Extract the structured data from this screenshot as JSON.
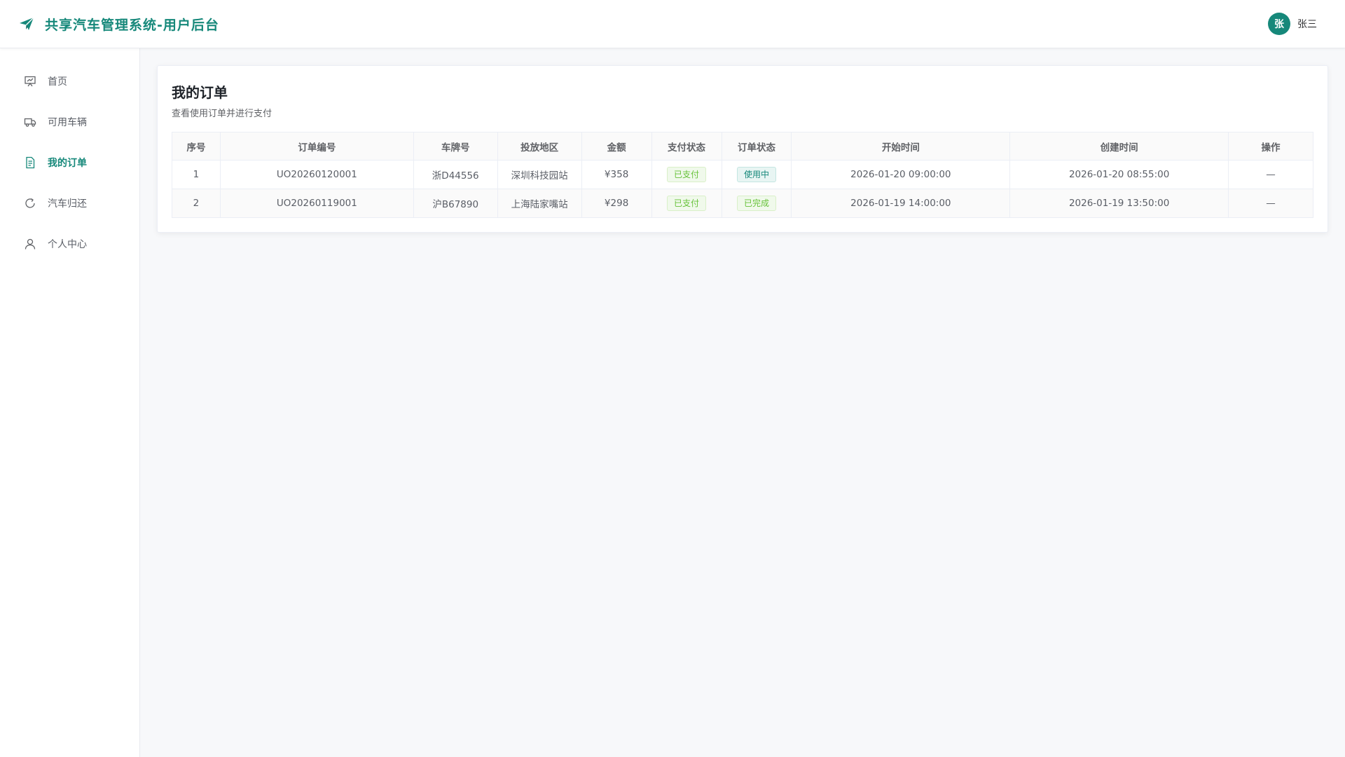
{
  "app": {
    "title": "共享汽车管理系统-用户后台"
  },
  "user": {
    "avatar_text": "张",
    "name": "张三"
  },
  "sidebar": {
    "items": [
      {
        "label": "首页",
        "icon": "presentation-board-icon",
        "active": false
      },
      {
        "label": "可用车辆",
        "icon": "truck-icon",
        "active": false
      },
      {
        "label": "我的订单",
        "icon": "document-list-icon",
        "active": true
      },
      {
        "label": "汽车归还",
        "icon": "refresh-icon",
        "active": false
      },
      {
        "label": "个人中心",
        "icon": "user-icon",
        "active": false
      }
    ]
  },
  "page": {
    "title": "我的订单",
    "subtitle": "查看使用订单并进行支付"
  },
  "table": {
    "columns": [
      "序号",
      "订单编号",
      "车牌号",
      "投放地区",
      "金额",
      "支付状态",
      "订单状态",
      "开始时间",
      "创建时间",
      "操作"
    ],
    "rows": [
      {
        "index": "1",
        "order_no": "UO20260120001",
        "plate": "浙D44556",
        "region": "深圳科技园站",
        "amount": "¥358",
        "pay_status": "已支付",
        "order_status": "使用中",
        "start_time": "2026-01-20 09:00:00",
        "created_time": "2026-01-20 08:55:00",
        "action": "—"
      },
      {
        "index": "2",
        "order_no": "UO20260119001",
        "plate": "沪B67890",
        "region": "上海陆家嘴站",
        "amount": "¥298",
        "pay_status": "已支付",
        "order_status": "已完成",
        "start_time": "2026-01-19 14:00:00",
        "created_time": "2026-01-19 13:50:00",
        "action": "—"
      }
    ]
  },
  "colors": {
    "brand": "#16887a",
    "paid": "#67c23a"
  }
}
